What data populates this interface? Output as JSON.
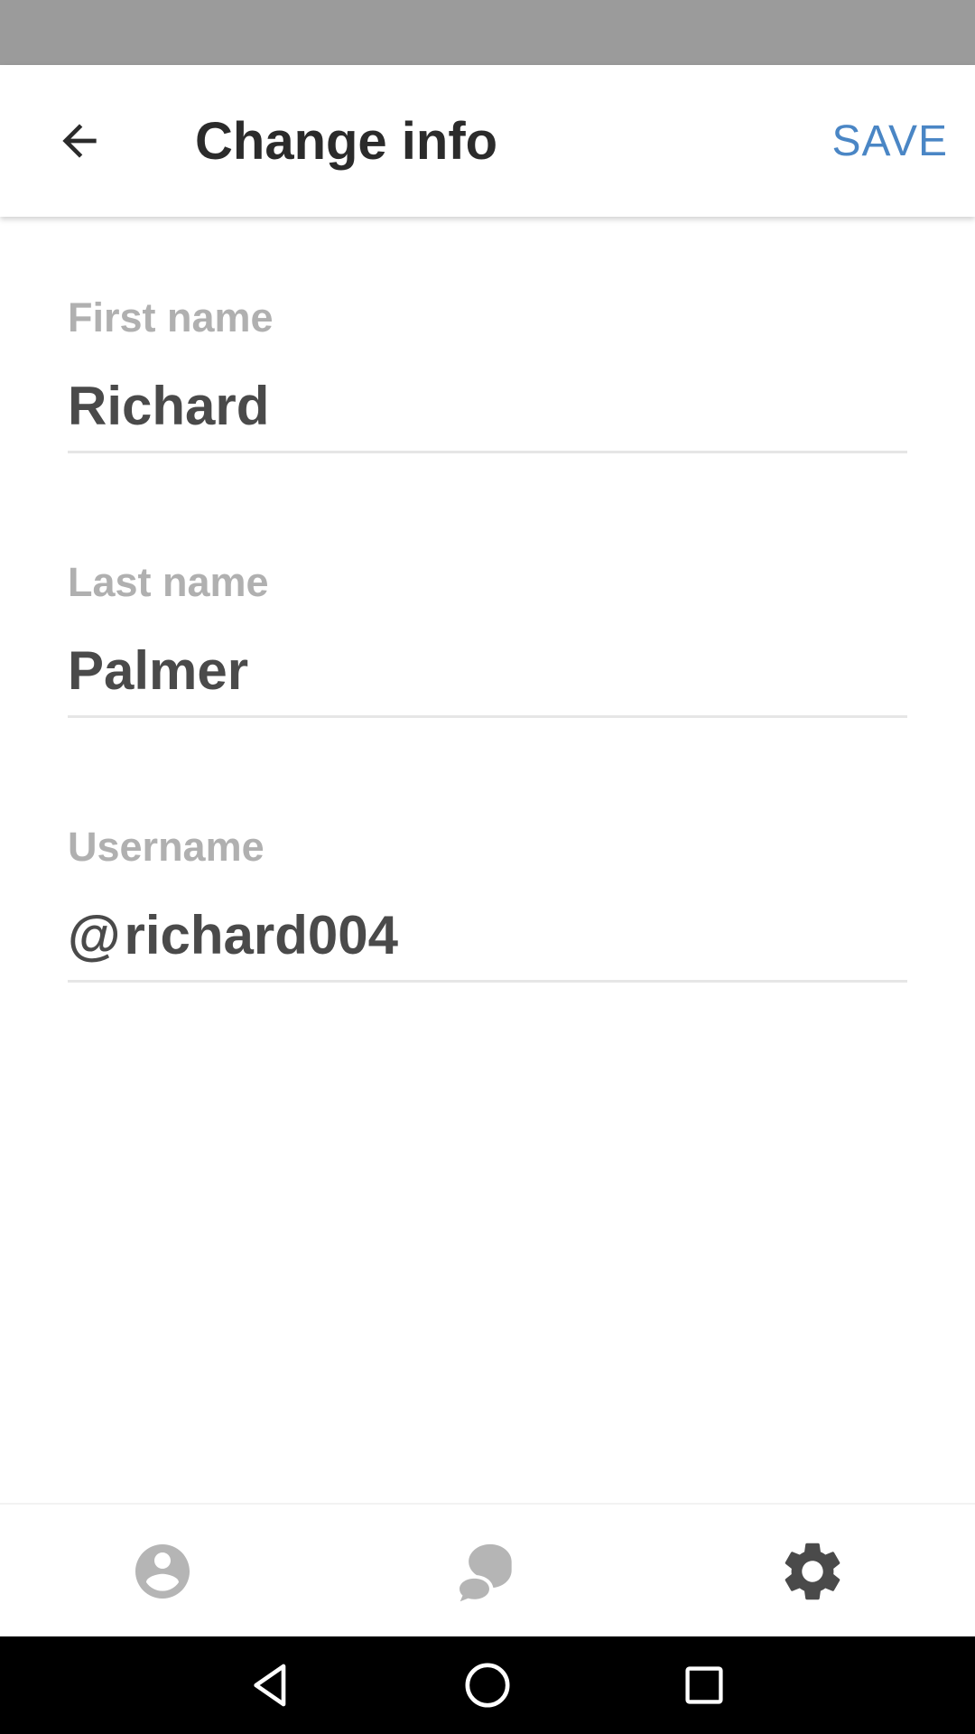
{
  "header": {
    "title": "Change info",
    "save_label": "SAVE",
    "back_icon": "arrow-left-icon"
  },
  "form": {
    "first_name": {
      "label": "First name",
      "value": "Richard"
    },
    "last_name": {
      "label": "Last name",
      "value": "Palmer"
    },
    "username": {
      "label": "Username",
      "prefix": "@",
      "value": "richard004"
    }
  },
  "bottom_nav": {
    "items": [
      {
        "icon": "account-circle-icon",
        "active": false
      },
      {
        "icon": "chat-bubbles-icon",
        "active": false
      },
      {
        "icon": "gear-icon",
        "active": true
      }
    ]
  },
  "system_nav": {
    "items": [
      "back-triangle-icon",
      "home-circle-icon",
      "recents-square-icon"
    ]
  },
  "colors": {
    "status_bar": "#9b9b9b",
    "accent": "#4a86c5",
    "title_text": "#2b2b2b",
    "label_text": "#b0b0b0",
    "value_text": "#4a4a4a",
    "inactive_icon": "#b5b5b5",
    "active_icon": "#4a4a4a"
  }
}
